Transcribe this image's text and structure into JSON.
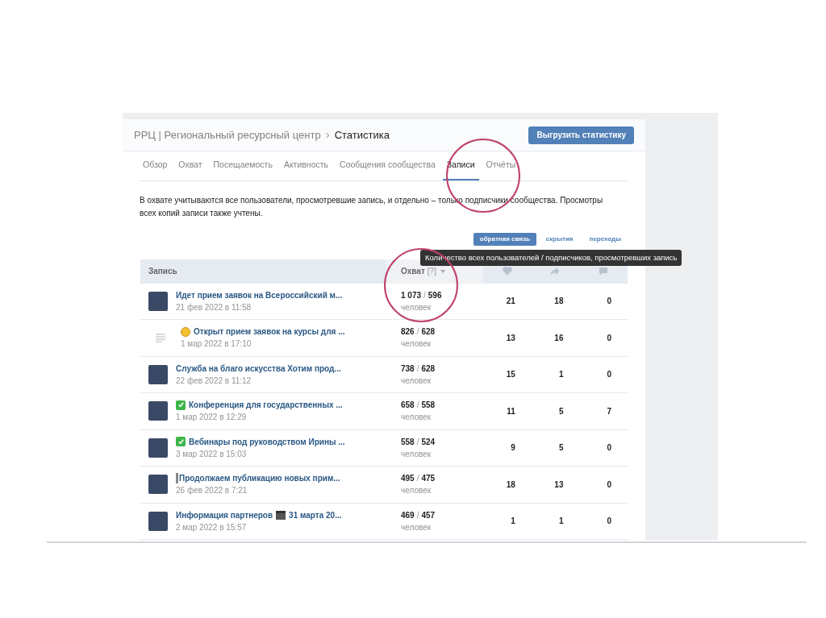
{
  "breadcrumb": {
    "group": "РРЦ | Региональный ресурсный центр",
    "separator": "›",
    "current": "Статистика"
  },
  "export_button": "Выгрузить статистику",
  "tabs": [
    {
      "label": "Обзор",
      "selected": false
    },
    {
      "label": "Охват",
      "selected": false
    },
    {
      "label": "Посещаемость",
      "selected": false
    },
    {
      "label": "Активность",
      "selected": false
    },
    {
      "label": "Сообщения сообщества",
      "selected": false
    },
    {
      "label": "Записи",
      "selected": true
    },
    {
      "label": "Отчёты",
      "selected": false
    }
  ],
  "description": "В охвате учитываются все пользователи, просмотревшие запись, и отдельно – только подписчики сообщества. Просмотры всех копий записи также учтены.",
  "filters": [
    {
      "label": "обратная связь",
      "selected": true
    },
    {
      "label": "скрытия",
      "selected": false
    },
    {
      "label": "переходы",
      "selected": false
    }
  ],
  "tooltip": "Количество всех пользователей / подписчиков, просмотревших запись",
  "table": {
    "columns": {
      "post": "Запись",
      "reach": "Охват",
      "help": "[?]"
    },
    "rows": [
      {
        "thumb": {
          "kind": "photo"
        },
        "separator": "/",
        "title": "Идет прием заявок на Всероссийский м...",
        "date": "21 фев 2022 в 11:58",
        "reach_all": "1 073",
        "reach_subs": "596",
        "unit": "человек",
        "likes": "21",
        "shares": "18",
        "comments": "0"
      },
      {
        "thumb": {
          "kind": "text"
        },
        "marker": {
          "kind": "face"
        },
        "separator": "/",
        "title": "Открыт прием заявок на курсы для ...",
        "date": "1 мар 2022 в 17:10",
        "reach_all": "826",
        "reach_subs": "628",
        "unit": "человек",
        "likes": "13",
        "shares": "16",
        "comments": "0"
      },
      {
        "thumb": {
          "kind": "photo"
        },
        "separator": "/",
        "title": "Служба на благо искусства Хотим прод...",
        "date": "22 фев 2022 в 11:12",
        "reach_all": "738",
        "reach_subs": "628",
        "unit": "человек",
        "likes": "15",
        "shares": "1",
        "comments": "0"
      },
      {
        "thumb": {
          "kind": "photo"
        },
        "marker": {
          "kind": "check"
        },
        "separator": "/",
        "title": "Конференция для государственных ...",
        "date": "1 мар 2022 в 12:29",
        "reach_all": "658",
        "reach_subs": "558",
        "unit": "человек",
        "likes": "11",
        "shares": "5",
        "comments": "7"
      },
      {
        "thumb": {
          "kind": "photo"
        },
        "marker": {
          "kind": "check"
        },
        "separator": "/",
        "title": "Вебинары под руководством Ирины ...",
        "date": "3 мар 2022 в 15:03",
        "reach_all": "558",
        "reach_subs": "524",
        "unit": "человек",
        "likes": "9",
        "shares": "5",
        "comments": "0"
      },
      {
        "thumb": {
          "kind": "photo"
        },
        "marker": {
          "kind": "bar"
        },
        "separator": "/",
        "title": "Продолжаем публикацию новых прим...",
        "date": "26 фев 2022 в 7:21",
        "reach_all": "495",
        "reach_subs": "475",
        "unit": "человек",
        "likes": "18",
        "shares": "13",
        "comments": "0"
      },
      {
        "thumb": {
          "kind": "photo"
        },
        "separator": "/",
        "title": "Информация партнеров",
        "inline_icon": {
          "kind": "clapper"
        },
        "title_tail": "31 марта 20...",
        "date": "2 мар 2022 в 15:57",
        "reach_all": "469",
        "reach_subs": "457",
        "unit": "человек",
        "likes": "1",
        "shares": "1",
        "comments": "0"
      }
    ]
  }
}
